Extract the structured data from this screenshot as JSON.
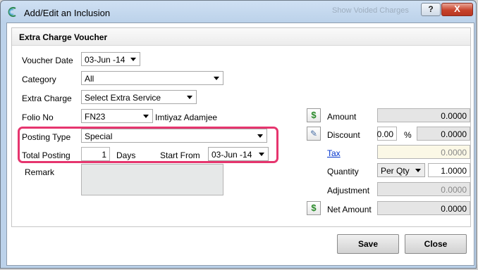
{
  "window": {
    "title": "Add/Edit an Inclusion",
    "ghost_title": "Show Voided Charges",
    "help_label": "?",
    "close_label": "X"
  },
  "panel": {
    "title": "Extra Charge Voucher"
  },
  "form": {
    "voucher_date": {
      "label": "Voucher Date",
      "value": "03-Jun -14"
    },
    "category": {
      "label": "Category",
      "value": "All"
    },
    "extra_charge": {
      "label": "Extra Charge",
      "value": "Select Extra Service"
    },
    "folio": {
      "label": "Folio No",
      "value": "FN23",
      "guest_name": "Imtiyaz Adamjee"
    },
    "posting_type": {
      "label": "Posting Type",
      "value": "Special"
    },
    "total_posting": {
      "label": "Total Posting",
      "value": "1",
      "unit": "Days"
    },
    "start_from": {
      "label": "Start From",
      "value": "03-Jun -14"
    },
    "remark": {
      "label": "Remark",
      "value": ""
    }
  },
  "summary": {
    "amount": {
      "label": "Amount",
      "value": "0.0000"
    },
    "discount": {
      "label": "Discount",
      "percent": "0.00",
      "percent_sign": "%",
      "value": "0.0000"
    },
    "tax": {
      "label": "Tax",
      "value": "0.0000"
    },
    "quantity": {
      "label": "Quantity",
      "mode": "Per Qty",
      "value": "1.0000"
    },
    "adjustment": {
      "label": "Adjustment",
      "value": "0.0000"
    },
    "net_amount": {
      "label": "Net Amount",
      "value": "0.0000"
    }
  },
  "buttons": {
    "save": "Save",
    "close": "Close"
  },
  "icons": {
    "money": "money-icon",
    "discount": "discount-icon"
  },
  "colors": {
    "highlight": "#e6356e",
    "link": "#0033cc"
  }
}
